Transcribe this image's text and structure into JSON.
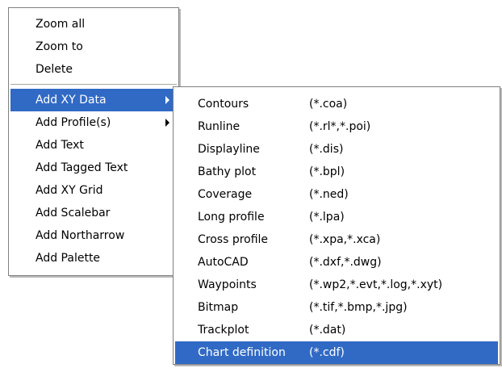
{
  "main_menu": {
    "group1": [
      "Zoom all",
      "Zoom to",
      "Delete"
    ],
    "group2": [
      {
        "label": "Add XY Data",
        "submenu": true,
        "selected": true
      },
      {
        "label": "Add Profile(s)",
        "submenu": true,
        "selected": false
      },
      {
        "label": "Add Text",
        "submenu": false,
        "selected": false
      },
      {
        "label": "Add Tagged Text",
        "submenu": false,
        "selected": false
      },
      {
        "label": "Add XY Grid",
        "submenu": false,
        "selected": false
      },
      {
        "label": "Add Scalebar",
        "submenu": false,
        "selected": false
      },
      {
        "label": "Add Northarrow",
        "submenu": false,
        "selected": false
      },
      {
        "label": "Add Palette",
        "submenu": false,
        "selected": false
      }
    ]
  },
  "sub_menu": {
    "items": [
      {
        "label": "Contours",
        "ext": "(*.coa)"
      },
      {
        "label": "Runline",
        "ext": "(*.rl*,*.poi)"
      },
      {
        "label": "Displayline",
        "ext": "(*.dis)"
      },
      {
        "label": "Bathy plot",
        "ext": "(*.bpl)"
      },
      {
        "label": "Coverage",
        "ext": "(*.ned)"
      },
      {
        "label": "Long profile",
        "ext": "(*.lpa)"
      },
      {
        "label": "Cross profile",
        "ext": "(*.xpa,*.xca)"
      },
      {
        "label": "AutoCAD",
        "ext": "(*.dxf,*.dwg)"
      },
      {
        "label": "Waypoints",
        "ext": "(*.wp2,*.evt,*.log,*.xyt)"
      },
      {
        "label": "Bitmap",
        "ext": "(*.tif,*.bmp,*.jpg)"
      },
      {
        "label": "Trackplot",
        "ext": "(*.dat)"
      },
      {
        "label": "Chart definition",
        "ext": "(*.cdf)"
      }
    ],
    "selected_index": 11
  },
  "colors": {
    "highlight": "#316ac5",
    "highlight_text": "#ffffff",
    "menu_border": "#808080",
    "separator": "#aca899"
  }
}
